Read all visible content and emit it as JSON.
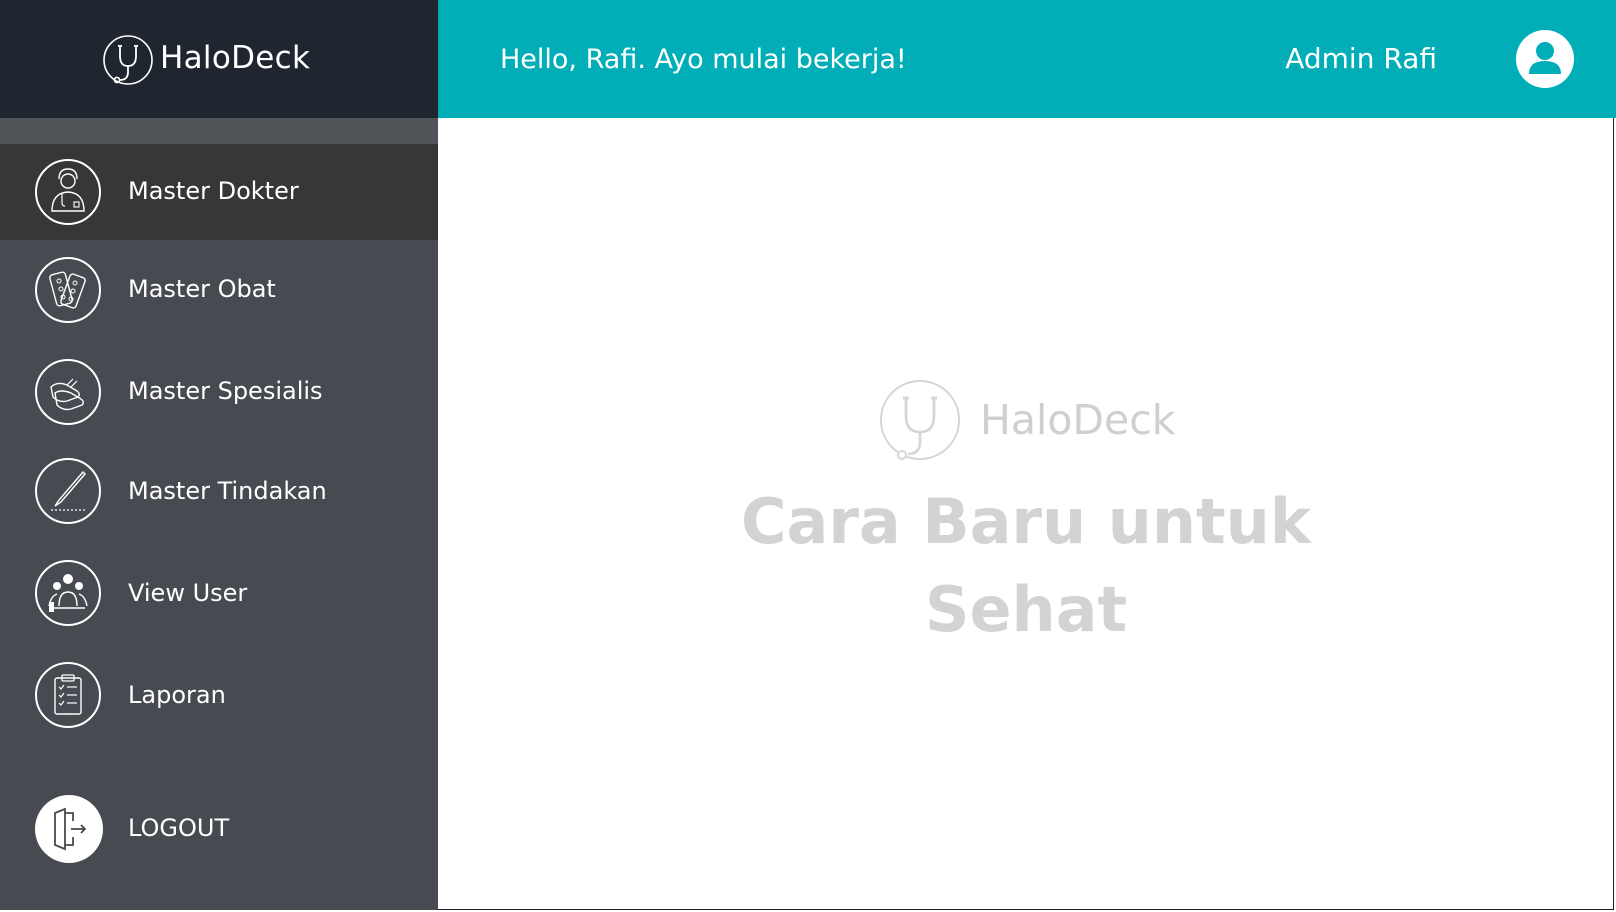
{
  "app": {
    "name": "HaloDeck"
  },
  "header": {
    "greeting": "Hello, Rafi. Ayo mulai bekerja!",
    "user_name": "Admin Rafi",
    "avatar_icon": "user-avatar-icon"
  },
  "sidebar": {
    "items": [
      {
        "label": "Master Dokter",
        "icon": "doctor-icon",
        "active": true
      },
      {
        "label": "Master Obat",
        "icon": "pills-icon",
        "active": false
      },
      {
        "label": "Master Spesialis",
        "icon": "gloves-icon",
        "active": false
      },
      {
        "label": "Master Tindakan",
        "icon": "scalpel-icon",
        "active": false
      },
      {
        "label": "View User",
        "icon": "users-icon",
        "active": false
      },
      {
        "label": "Laporan",
        "icon": "clipboard-icon",
        "active": false
      }
    ],
    "logout": {
      "label": "LOGOUT",
      "icon": "logout-icon"
    }
  },
  "main": {
    "brand": "HaloDeck",
    "tagline_line1": "Cara Baru untuk",
    "tagline_line2": "Sehat"
  },
  "colors": {
    "accent": "#01aeb7",
    "brand_bg": "#20262f",
    "sidebar_bg": "#474a50",
    "active_item_bg": "#363739",
    "tagline": "#d3d3d3"
  }
}
